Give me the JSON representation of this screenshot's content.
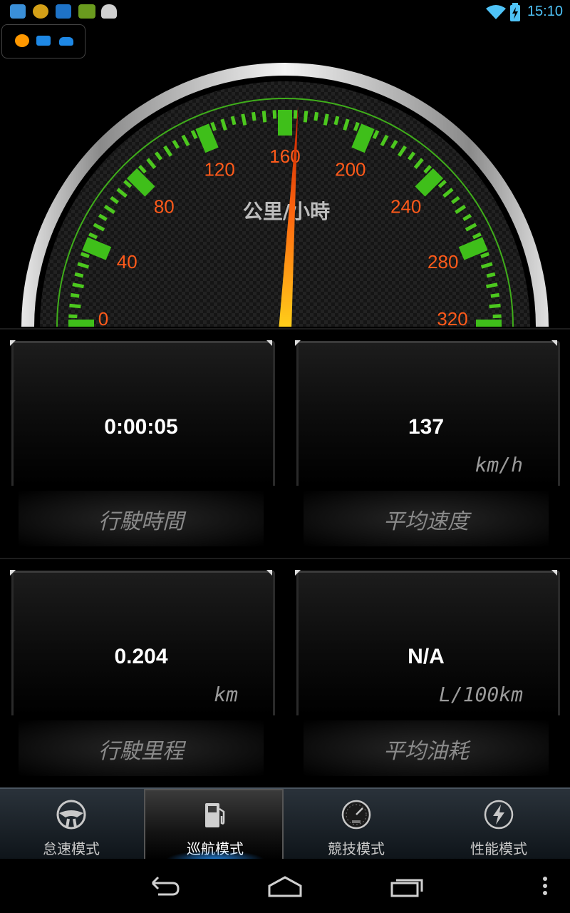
{
  "status_bar": {
    "time": "15:10",
    "left_icons": [
      "maps-icon",
      "coin-icon",
      "app-icon",
      "battery-app-icon",
      "android-icon"
    ],
    "right_icons": [
      "wifi-icon",
      "battery-charging-icon"
    ]
  },
  "obd_indicator": [
    "obd-status-icon",
    "obd-adapter-icon",
    "car-connected-icon"
  ],
  "gauge": {
    "unit_label": "公里/小時",
    "tick_labels": [
      "0",
      "40",
      "80",
      "120",
      "160",
      "200",
      "240",
      "280",
      "320"
    ],
    "min": 0,
    "max": 320,
    "needle_value": 166,
    "colors": {
      "tick": "#4cc81e",
      "label": "#ff5a1a",
      "needle": "#ff4a10"
    }
  },
  "stats": [
    {
      "value": "0:00:05",
      "unit": "",
      "label": "行駛時間"
    },
    {
      "value": "137",
      "unit": "km/h",
      "label": "平均速度"
    },
    {
      "value": "0.204",
      "unit": "km",
      "label": "行駛里程"
    },
    {
      "value": "N/A",
      "unit": "L/100km",
      "label": "平均油耗"
    }
  ],
  "tabs": [
    {
      "label": "怠速模式",
      "icon": "steering-wheel-icon",
      "active": false
    },
    {
      "label": "巡航模式",
      "icon": "fuel-pump-icon",
      "active": true
    },
    {
      "label": "競技模式",
      "icon": "speedometer-icon",
      "active": false
    },
    {
      "label": "性能模式",
      "icon": "lightning-icon",
      "active": false
    }
  ],
  "nav": [
    "back-icon",
    "home-icon",
    "recent-apps-icon",
    "menu-icon"
  ]
}
